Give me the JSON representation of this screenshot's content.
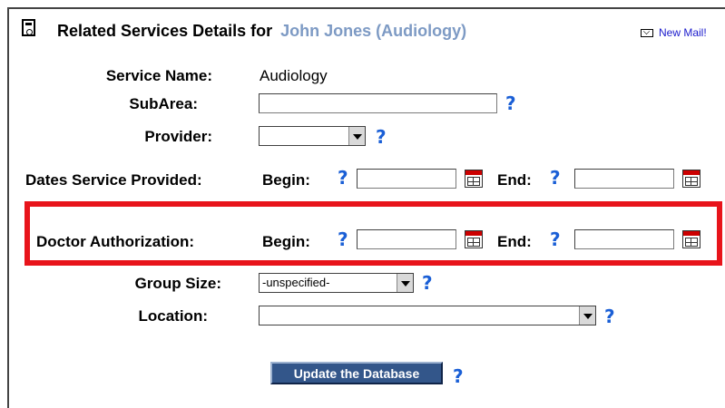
{
  "header": {
    "title_prefix": "Related Services Details for",
    "student_name": "John Jones (Audiology)",
    "new_mail_link": "New Mail!",
    "name_color": "#7d9ac4",
    "link_color": "#1a1acc"
  },
  "form": {
    "service_name_label": "Service Name:",
    "service_name_value": "Audiology",
    "subarea_label": "SubArea:",
    "subarea_value": "",
    "provider_label": "Provider:",
    "provider_value": "",
    "dates_label": "Dates Service Provided:",
    "dates_begin_label": "Begin:",
    "dates_end_label": "End:",
    "auth_label": "Doctor Authorization:",
    "auth_begin_label": "Begin:",
    "auth_end_label": "End:",
    "group_size_label": "Group Size:",
    "group_size_value": "-unspecified-",
    "location_label": "Location:",
    "location_value": "",
    "help_glyph": "?",
    "submit_label": "Update the Database"
  },
  "highlight_color": "#e8141b"
}
